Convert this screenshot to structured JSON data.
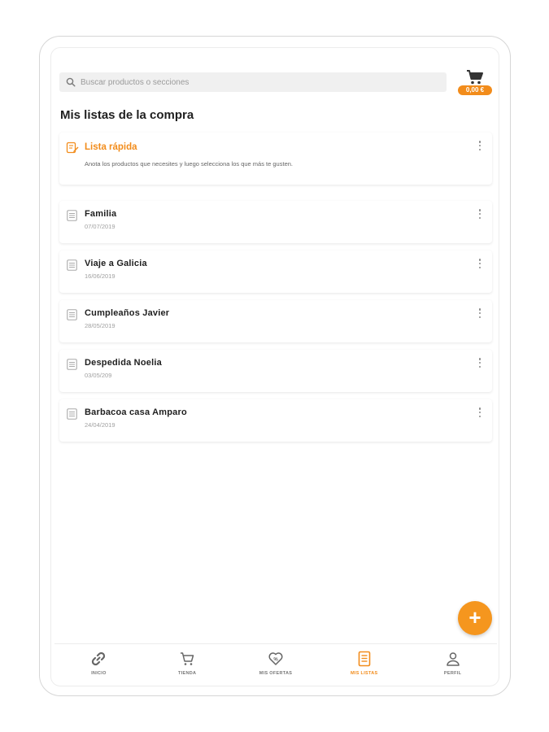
{
  "search": {
    "placeholder": "Buscar productos o secciones"
  },
  "cart": {
    "total": "0,00 €"
  },
  "page_title": "Mis listas de la compra",
  "quick_list": {
    "title": "Lista rápida",
    "description": "Anota los productos que necesites y luego selecciona los que más te gusten."
  },
  "lists": [
    {
      "name": "Familia",
      "date": "07/07/2019"
    },
    {
      "name": "Viaje a Galicia",
      "date": "16/06/2019"
    },
    {
      "name": "Cumpleaños Javier",
      "date": "28/05/2019"
    },
    {
      "name": "Despedida Noelia",
      "date": "03/05/209"
    },
    {
      "name": "Barbacoa casa Amparo",
      "date": "24/04/2019"
    }
  ],
  "fab": {
    "label": "+"
  },
  "nav": [
    {
      "label": "INICIO",
      "icon": "link-icon"
    },
    {
      "label": "TIENDA",
      "icon": "cart-icon"
    },
    {
      "label": "MIS OFERTAS",
      "icon": "heart-icon"
    },
    {
      "label": "MIS LISTAS",
      "icon": "list-icon"
    },
    {
      "label": "PERFIL",
      "icon": "user-icon"
    }
  ],
  "colors": {
    "accent": "#f28c1b",
    "text": "#1f1f1f",
    "muted": "#a0a0a0"
  }
}
